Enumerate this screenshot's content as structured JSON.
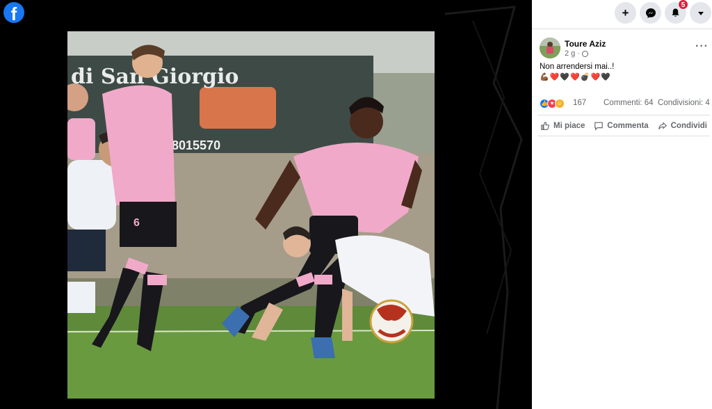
{
  "brand": {
    "logo_letter": "f"
  },
  "photo": {
    "banner_text": "di San Giorgio",
    "banner_phone": "8015570",
    "shirt_number": "6"
  },
  "topbar": {
    "create_icon": "plus-icon",
    "messenger_icon": "messenger-icon",
    "notifications_icon": "bell-icon",
    "notifications_badge": "5",
    "account_icon": "caret-down-icon"
  },
  "post": {
    "author": "Toure Aziz",
    "time": "2 g",
    "text": "Non arrendersi mai..!",
    "emojis": "💪🏾❤️🖤❤️💣❤️🖤",
    "reactions_count": "167",
    "comments": "Commenti: 64",
    "shares": "Condivisioni: 4"
  },
  "actions": {
    "like": "Mi piace",
    "comment": "Commenta",
    "share": "Condividi"
  },
  "colors": {
    "facebook_blue": "#1877f2",
    "badge_red": "#e41e3f",
    "jersey_pink": "#f1a9c9"
  }
}
